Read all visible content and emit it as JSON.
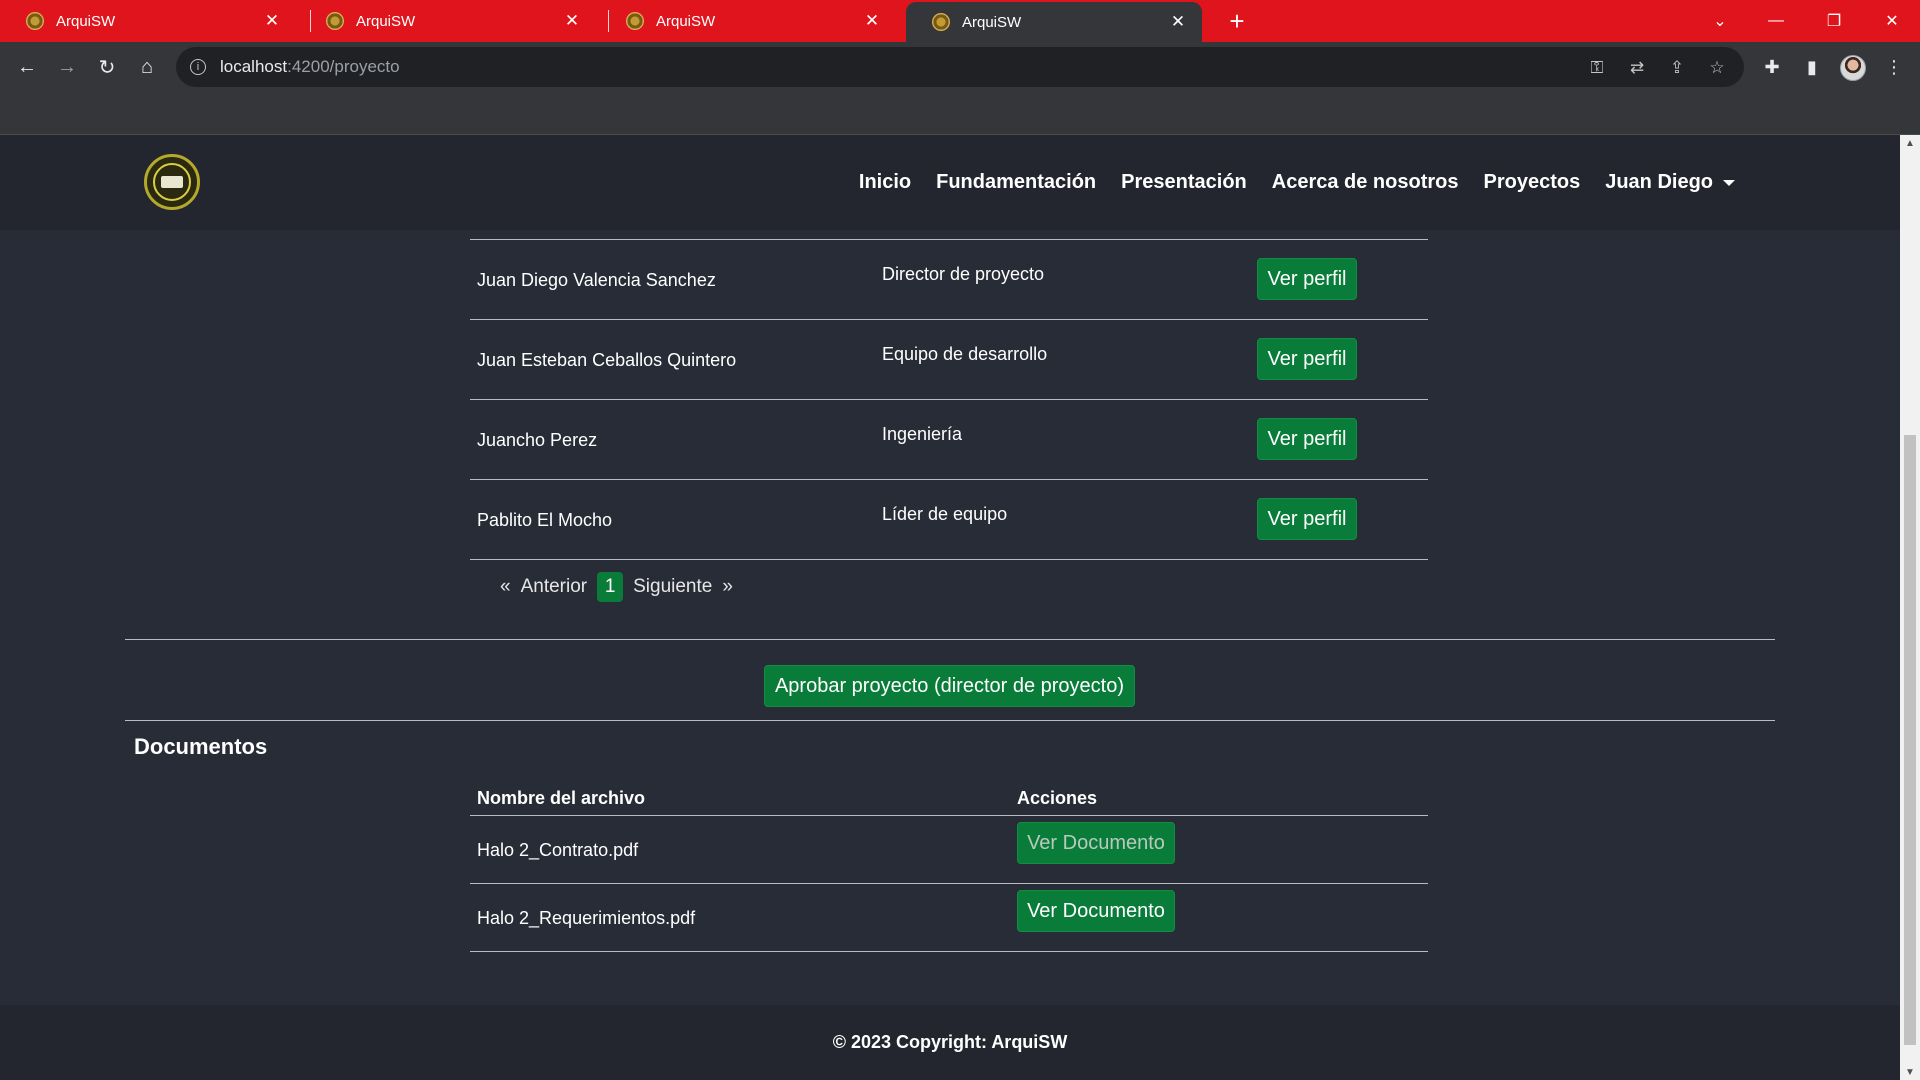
{
  "browser": {
    "tabs": [
      {
        "title": "ArquiSW",
        "active": false
      },
      {
        "title": "ArquiSW",
        "active": false
      },
      {
        "title": "ArquiSW",
        "active": false
      },
      {
        "title": "ArquiSW",
        "active": true
      }
    ],
    "url_host": "localhost",
    "url_rest": ":4200/proyecto"
  },
  "nav": {
    "links": [
      "Inicio",
      "Fundamentación",
      "Presentación",
      "Acerca de nosotros",
      "Proyectos"
    ],
    "user": "Juan Diego"
  },
  "members": [
    {
      "name": "Juan Diego Valencia Sanchez",
      "role": "Director de proyecto",
      "action": "Ver perfil"
    },
    {
      "name": "Juan Esteban Ceballos Quintero",
      "role": "Equipo de desarrollo",
      "action": "Ver perfil"
    },
    {
      "name": "Juancho Perez",
      "role": "Ingeniería",
      "action": "Ver perfil"
    },
    {
      "name": "Pablito El Mocho",
      "role": "Líder de equipo",
      "action": "Ver perfil"
    }
  ],
  "pagination": {
    "first": "«",
    "prev": "Anterior",
    "current": "1",
    "next": "Siguiente",
    "last": "»"
  },
  "approve_button": "Aprobar proyecto (director de proyecto)",
  "documents": {
    "title": "Documentos",
    "col_name": "Nombre del archivo",
    "col_actions": "Acciones",
    "rows": [
      {
        "file": "Halo 2_Contrato.pdf",
        "action": "Ver Documento"
      },
      {
        "file": "Halo 2_Requerimientos.pdf",
        "action": "Ver Documento"
      }
    ]
  },
  "footer": "© 2023 Copyright: ArquiSW",
  "colors": {
    "tabstrip": "#e0141c",
    "page_bg": "#282c37",
    "navbar_bg": "#23262f",
    "button_green": "#0a7c3a"
  }
}
